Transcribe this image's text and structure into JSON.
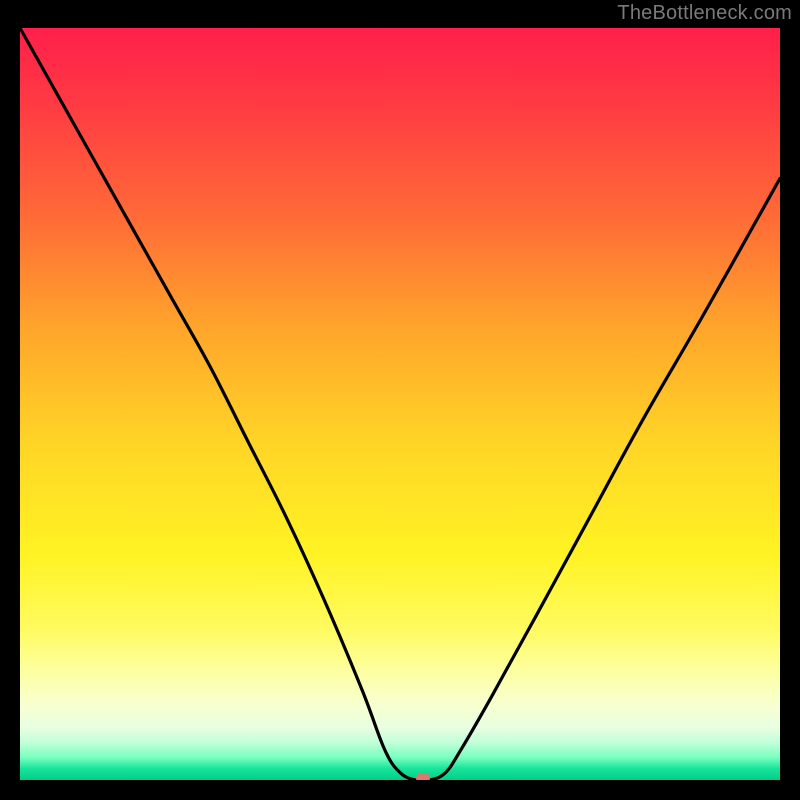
{
  "watermark": "TheBottleneck.com",
  "chart_data": {
    "type": "line",
    "title": "",
    "xlabel": "",
    "ylabel": "",
    "xlim": [
      0,
      100
    ],
    "ylim": [
      0,
      100
    ],
    "grid": false,
    "legend": false,
    "series": [
      {
        "name": "bottleneck-curve",
        "x": [
          0,
          5,
          10,
          15,
          20,
          25,
          30,
          35,
          40,
          45,
          48,
          50,
          52,
          54,
          56,
          58,
          62,
          68,
          75,
          82,
          90,
          100
        ],
        "y": [
          100,
          91,
          82,
          73,
          64,
          55,
          45,
          35,
          24,
          12,
          4,
          1,
          0,
          0,
          1,
          4,
          11,
          22,
          35,
          48,
          62,
          80
        ]
      }
    ],
    "marker": {
      "x": 53,
      "y": 0,
      "color": "#d97a6e"
    },
    "background_gradient_stops": [
      {
        "pos": 0,
        "color": "#ff1f4b"
      },
      {
        "pos": 25,
        "color": "#ff6a37"
      },
      {
        "pos": 55,
        "color": "#ffd426"
      },
      {
        "pos": 80,
        "color": "#fffb60"
      },
      {
        "pos": 95,
        "color": "#c2ffd9"
      },
      {
        "pos": 100,
        "color": "#00cf8a"
      }
    ]
  }
}
